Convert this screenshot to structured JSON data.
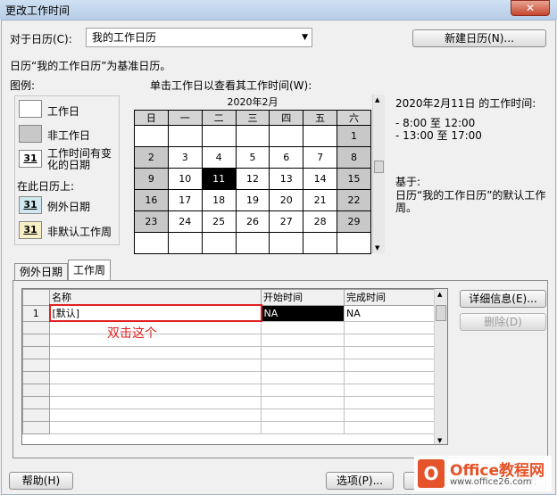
{
  "window": {
    "title": "更改工作时间",
    "close_glyph": "✕"
  },
  "calendar_for": {
    "label": "对于日历(C):",
    "value": "我的工作日历"
  },
  "new_calendar_button": "新建日历(N)...",
  "base_calendar_text": "日历“我的工作日历”为基准日历。",
  "legend": {
    "title": "图例:",
    "working": "工作日",
    "nonworking": "非工作日",
    "edited_hours": "工作时间有变化的日期",
    "on_this_calendar": "在此日历上:",
    "exception_day": "例外日期",
    "nondefault_week": "非默认工作周",
    "badge_num": "31"
  },
  "calendar": {
    "instruction": "单击工作日以查看其工作时间(W):",
    "month": "2020年2月",
    "weekdays": [
      "日",
      "一",
      "二",
      "三",
      "四",
      "五",
      "六"
    ],
    "weeks": [
      [
        "",
        "",
        "",
        "",
        "",
        "",
        "1"
      ],
      [
        "2",
        "3",
        "4",
        "5",
        "6",
        "7",
        "8"
      ],
      [
        "9",
        "10",
        "11",
        "12",
        "13",
        "14",
        "15"
      ],
      [
        "16",
        "17",
        "18",
        "19",
        "20",
        "21",
        "22"
      ],
      [
        "23",
        "24",
        "25",
        "26",
        "27",
        "28",
        "29"
      ],
      [
        "",
        "",
        "",
        "",
        "",
        "",
        ""
      ]
    ],
    "selected_day": "11"
  },
  "work_times": {
    "heading": "2020年2月11日 的工作时间:",
    "line1": "- 8:00 至 12:00",
    "line2": "- 13:00 至 17:00",
    "based_on_label": "基于:",
    "based_on_text": "日历“我的工作日历”的默认工作周。"
  },
  "tabs": {
    "exceptions": "例外日期",
    "work_weeks": "工作周"
  },
  "grid": {
    "headers": {
      "name": "名称",
      "start": "开始时间",
      "finish": "完成时间"
    },
    "rows": [
      {
        "num": "1",
        "name": "[默认]",
        "start": "NA",
        "finish": "NA"
      }
    ]
  },
  "side_buttons": {
    "details": "详细信息(E)...",
    "delete": "删除(D)"
  },
  "annotation": {
    "text": "双击这个",
    "color": "#e02020"
  },
  "footer": {
    "help": "帮助(H)",
    "options": "选项(P)...",
    "ok_partial": "定",
    "cancel_partial": "关闭"
  },
  "watermark": {
    "brand": "Office教程网",
    "url": "www.office26.com"
  }
}
